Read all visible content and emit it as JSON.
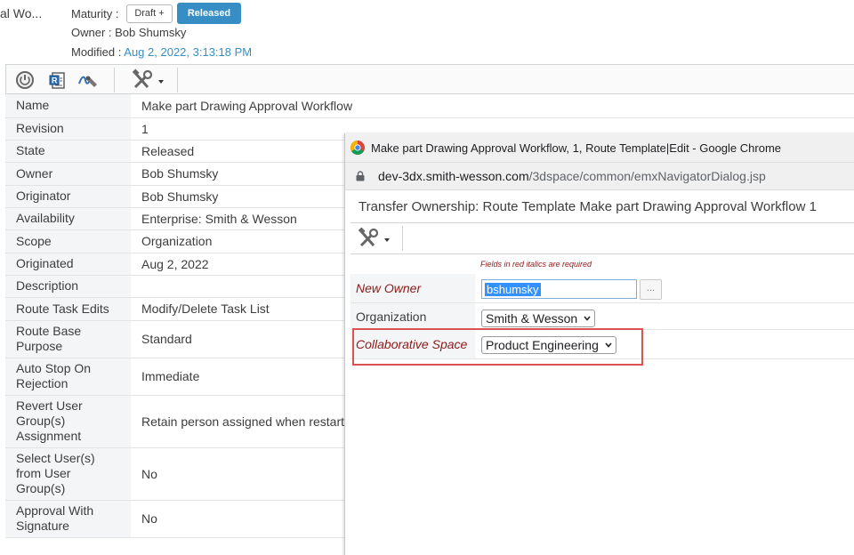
{
  "header": {
    "title_fragment": "al Wo...",
    "maturity_label": "Maturity :",
    "draft_button": "Draft +",
    "released_button": "Released",
    "owner_text": "Owner : Bob Shumsky",
    "modified_label": "Modified :",
    "modified_value": "Aug 2, 2022, 3:13:18 PM"
  },
  "toolbar": {
    "icons": [
      "power-icon",
      "report-icon",
      "sign-icon",
      "tools-menu-icon"
    ]
  },
  "properties": [
    {
      "label": "Name",
      "value": "Make part Drawing Approval Workflow"
    },
    {
      "label": "Revision",
      "value": "1"
    },
    {
      "label": "State",
      "value": "Released"
    },
    {
      "label": "Owner",
      "value": "Bob Shumsky"
    },
    {
      "label": "Originator",
      "value": "Bob Shumsky"
    },
    {
      "label": "Availability",
      "value": "Enterprise: Smith & Wesson"
    },
    {
      "label": "Scope",
      "value": "Organization"
    },
    {
      "label": "Originated",
      "value": "Aug 2, 2022"
    },
    {
      "label": "Description",
      "value": ""
    },
    {
      "label": "Route Task Edits",
      "value": "Modify/Delete Task List"
    },
    {
      "label": "Route Base Purpose",
      "value": "Standard"
    },
    {
      "label": "Auto Stop On Rejection",
      "value": "Immediate"
    },
    {
      "label": "Revert User Group(s) Assignment",
      "value": "Retain person assigned when restart"
    },
    {
      "label": "Select User(s) from User Group(s)",
      "value": "No"
    },
    {
      "label": "Approval With Signature",
      "value": "No"
    }
  ],
  "popup": {
    "window_title": "Make part Drawing Approval Workflow, 1, Route Template|Edit - Google Chrome",
    "url_host": "dev-3dx.smith-wesson.com",
    "url_path": "/3dspace/common/emxNavigatorDialog.jsp",
    "dialog_title": "Transfer Ownership: Route Template Make part Drawing Approval Workflow 1",
    "required_note": "Fields in red italics are required",
    "new_owner_label": "New Owner",
    "new_owner_value": "bshumsky",
    "browse_button": "...",
    "organization_label": "Organization",
    "organization_value": "Smith & Wesson",
    "collab_space_label": "Collaborative Space",
    "collab_space_value": "Product Engineering"
  },
  "colors": {
    "accent": "#368ec4",
    "required_label": "#8b1a1a",
    "highlight": "#d9534f"
  }
}
